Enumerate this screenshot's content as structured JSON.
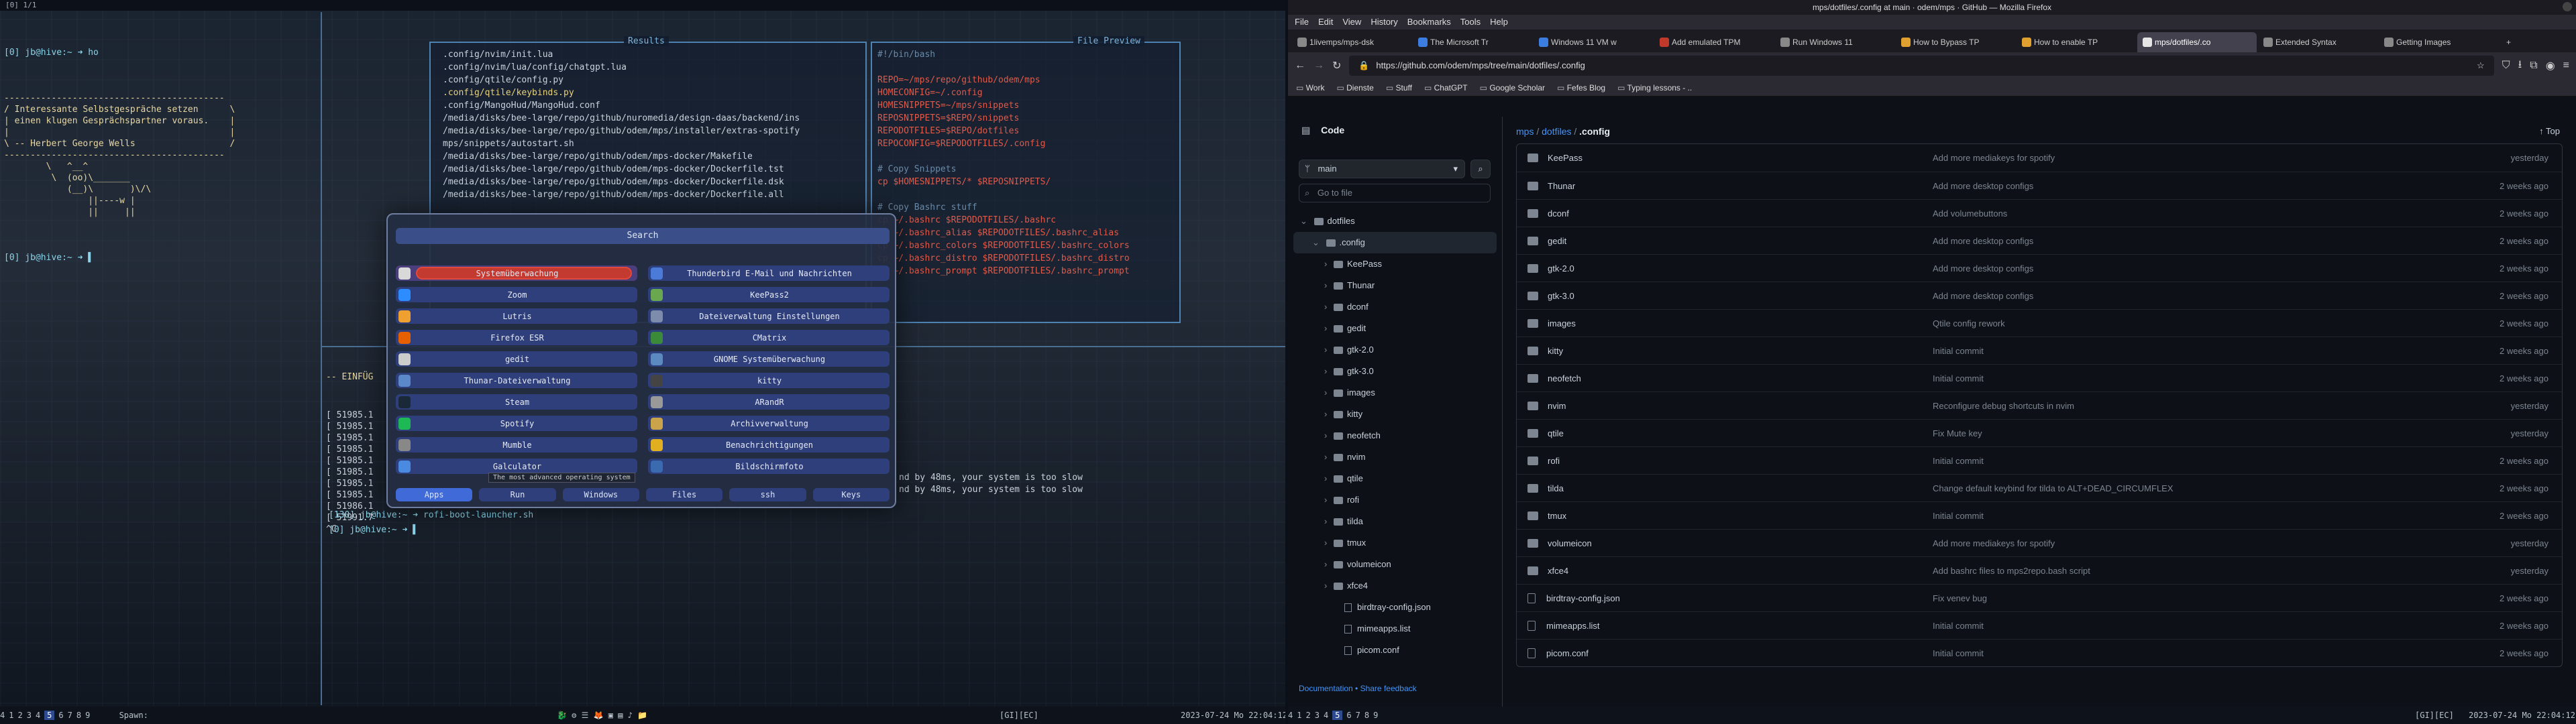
{
  "left": {
    "topbar": "[0] 1/1",
    "term1": {
      "prompt1": "[0] jb@hive:~ ➜ ho",
      "fortune": [
        "------------------------------------------",
        "/ Interessante Selbstgespräche setzen      \\",
        "| einen klugen Gesprächspartner voraus.    |",
        "|                                          |",
        "\\ -- Herbert George Wells                  /",
        "------------------------------------------",
        "        \\   ^__^",
        "         \\  (oo)\\_______",
        "            (__)\\       )\\/\\",
        "                ||----w |",
        "                ||     ||"
      ],
      "prompt2": "[0] jb@hive:~ ➜ ▌"
    },
    "results": {
      "title": "Results",
      "lines": [
        ".config/nvim/init.lua",
        ".config/nvim/lua/config/chatgpt.lua",
        ".config/qtile/config.py",
        ".config/qtile/keybinds.py",
        ".config/MangoHud/MangoHud.conf",
        "/media/disks/bee-large/repo/github/nuromedia/design-daas/backend/ins",
        "/media/disks/bee-large/repo/github/odem/mps/installer/extras-spotify",
        "mps/snippets/autostart.sh",
        "/media/disks/bee-large/repo/github/odem/mps-docker/Makefile",
        "/media/disks/bee-large/repo/github/odem/mps-docker/Dockerfile.tst",
        "/media/disks/bee-large/repo/github/odem/mps-docker/Dockerfile.dsk",
        "/media/disks/bee-large/repo/github/odem/mps-docker/Dockerfile.all"
      ]
    },
    "preview": {
      "title": "File Preview",
      "lines": [
        "#!/bin/bash",
        "",
        "REPO=~/mps/repo/github/odem/mps",
        "HOMECONFIG=~/.config",
        "HOMESNIPPETS=~/mps/snippets",
        "REPOSNIPPETS=$REPO/snippets",
        "REPODOTFILES=$REPO/dotfiles",
        "REPOCONFIG=$REPODOTFILES/.config",
        "",
        "# Copy Snippets",
        "cp $HOMESNIPPETS/* $REPOSNIPPETS/",
        "",
        "# Copy Bashrc stuff",
        "cp ~/.bashrc $REPODOTFILES/.bashrc",
        "cp ~/.bashrc_alias $REPODOTFILES/.bashrc_alias",
        "cp ~/.bashrc_colors $REPODOTFILES/.bashrc_colors",
        "cp ~/.bashrc_distro $REPODOTFILES/.bashrc_distro",
        "cp ~/.bashrc_prompt $REPODOTFILES/.bashrc_prompt"
      ]
    },
    "term2": {
      "header": "-- EINFÜG",
      "lines": [
        "[ 51985.1",
        "[ 51985.1",
        "[ 51985.1",
        "[ 51985.1",
        "[ 51985.1",
        "[ 51985.1",
        "[ 51985.1",
        "[ 51985.1",
        "[ 51986.1",
        "[ 51991.7",
        "^C"
      ],
      "slow1": "nd by 48ms, your system is too slow",
      "slow2": "nd by 48ms, your system is too slow",
      "prompt3": "[130] jb@hive:~ ➜ rofi-boot-launcher.sh",
      "prompt4": "[0] jb@hive:~ ➜ ▌"
    },
    "rofi": {
      "search": "Search",
      "items": [
        {
          "label": "Systemüberwachung",
          "color": "#d9d9d9"
        },
        {
          "label": "Thunderbird E-Mail und Nachrichten",
          "color": "#4a7bd8"
        },
        {
          "label": "Zoom",
          "color": "#2d8cff"
        },
        {
          "label": "KeePass2",
          "color": "#6aa84f"
        },
        {
          "label": "Lutris",
          "color": "#f0a030"
        },
        {
          "label": "Dateiverwaltung Einstellungen",
          "color": "#7d8cab"
        },
        {
          "label": "Firefox ESR",
          "color": "#e66000"
        },
        {
          "label": "CMatrix",
          "color": "#3a8a3a"
        },
        {
          "label": "gedit",
          "color": "#cccccc"
        },
        {
          "label": "GNOME Systemüberwachung",
          "color": "#5a8ac0"
        },
        {
          "label": "Thunar-Dateiverwaltung",
          "color": "#5b88c8"
        },
        {
          "label": "kitty",
          "color": "#444444"
        },
        {
          "label": "Steam",
          "color": "#1b2838"
        },
        {
          "label": "ARandR",
          "color": "#999999"
        },
        {
          "label": "Spotify",
          "color": "#1db954"
        },
        {
          "label": "Archivverwaltung",
          "color": "#c9a44a"
        },
        {
          "label": "Mumble",
          "color": "#888888"
        },
        {
          "label": "Benachrichtigungen",
          "color": "#e0b020"
        },
        {
          "label": "Galculator",
          "color": "#4a8ae0"
        },
        {
          "label": "Bildschirmfoto",
          "color": "#3a6ab0"
        }
      ],
      "tooltip": "The most advanced operating system",
      "tabs": [
        "Apps",
        "Run",
        "Windows",
        "Files",
        "ssh",
        "Keys"
      ]
    },
    "statusbar": {
      "workspaces": [
        "4",
        "1",
        "2",
        "3",
        "4",
        "5",
        "6",
        "7",
        "8",
        "9"
      ],
      "icons": "🐉 ⚙ ☰ 🦊 ▣ ▤ ♪ 📁",
      "layout": "[GI][EC]",
      "datetime": "2023-07-24 Mo 22:04:12",
      "spawn": "Spawn:"
    }
  },
  "right": {
    "window_title": "mps/dotfiles/.config at main · odem/mps · GitHub — Mozilla Firefox",
    "menu": [
      "File",
      "Edit",
      "View",
      "History",
      "Bookmarks",
      "Tools",
      "Help"
    ],
    "tabs": [
      "1livemps/mps-dsk",
      "The Microsoft Tr",
      "Windows 11 VM w",
      "Add emulated TPM",
      "Run Windows 11",
      "How to Bypass TP",
      "How to enable TP",
      "mps/dotfiles/.co",
      "Extended Syntax",
      "Getting Images"
    ],
    "url": "https://github.com/odem/mps/tree/main/dotfiles/.config",
    "bookmarks": [
      "Work",
      "Dienste",
      "Stuff",
      "ChatGPT",
      "Google Scholar",
      "Fefes Blog",
      "Typing lessons - .."
    ],
    "code_label": "Code",
    "branch": "main",
    "goto_placeholder": "Go to file",
    "breadcrumb": [
      "mps",
      "dotfiles",
      ".config"
    ],
    "top_label": "Top",
    "tree": [
      {
        "label": "dotfiles",
        "level": 0,
        "type": "dir"
      },
      {
        "label": ".config",
        "level": 1,
        "type": "dir",
        "sel": true
      },
      {
        "label": "KeePass",
        "level": 2,
        "type": "dir"
      },
      {
        "label": "Thunar",
        "level": 2,
        "type": "dir"
      },
      {
        "label": "dconf",
        "level": 2,
        "type": "dir"
      },
      {
        "label": "gedit",
        "level": 2,
        "type": "dir"
      },
      {
        "label": "gtk-2.0",
        "level": 2,
        "type": "dir"
      },
      {
        "label": "gtk-3.0",
        "level": 2,
        "type": "dir"
      },
      {
        "label": "images",
        "level": 2,
        "type": "dir"
      },
      {
        "label": "kitty",
        "level": 2,
        "type": "dir"
      },
      {
        "label": "neofetch",
        "level": 2,
        "type": "dir"
      },
      {
        "label": "nvim",
        "level": 2,
        "type": "dir"
      },
      {
        "label": "qtile",
        "level": 2,
        "type": "dir"
      },
      {
        "label": "rofi",
        "level": 2,
        "type": "dir"
      },
      {
        "label": "tilda",
        "level": 2,
        "type": "dir"
      },
      {
        "label": "tmux",
        "level": 2,
        "type": "dir"
      },
      {
        "label": "volumeicon",
        "level": 2,
        "type": "dir"
      },
      {
        "label": "xfce4",
        "level": 2,
        "type": "dir"
      },
      {
        "label": "birdtray-config.json",
        "level": 2,
        "type": "file"
      },
      {
        "label": "mimeapps.list",
        "level": 2,
        "type": "file"
      },
      {
        "label": "picom.conf",
        "level": 2,
        "type": "file"
      }
    ],
    "footer": "Documentation • Share feedback",
    "files": [
      {
        "name": "KeePass",
        "type": "dir",
        "commit": "Add more mediakeys for spotify",
        "date": "yesterday"
      },
      {
        "name": "Thunar",
        "type": "dir",
        "commit": "Add more desktop configs",
        "date": "2 weeks ago"
      },
      {
        "name": "dconf",
        "type": "dir",
        "commit": "Add volumebuttons",
        "date": "2 weeks ago"
      },
      {
        "name": "gedit",
        "type": "dir",
        "commit": "Add more desktop configs",
        "date": "2 weeks ago"
      },
      {
        "name": "gtk-2.0",
        "type": "dir",
        "commit": "Add more desktop configs",
        "date": "2 weeks ago"
      },
      {
        "name": "gtk-3.0",
        "type": "dir",
        "commit": "Add more desktop configs",
        "date": "2 weeks ago"
      },
      {
        "name": "images",
        "type": "dir",
        "commit": "Qtile config rework",
        "date": "2 weeks ago"
      },
      {
        "name": "kitty",
        "type": "dir",
        "commit": "Initial commit",
        "date": "2 weeks ago"
      },
      {
        "name": "neofetch",
        "type": "dir",
        "commit": "Initial commit",
        "date": "2 weeks ago"
      },
      {
        "name": "nvim",
        "type": "dir",
        "commit": "Reconfigure debug shortcuts in nvim",
        "date": "yesterday"
      },
      {
        "name": "qtile",
        "type": "dir",
        "commit": "Fix Mute key",
        "date": "yesterday"
      },
      {
        "name": "rofi",
        "type": "dir",
        "commit": "Initial commit",
        "date": "2 weeks ago"
      },
      {
        "name": "tilda",
        "type": "dir",
        "commit": "Change default keybind for tilda to ALT+DEAD_CIRCUMFLEX",
        "date": "2 weeks ago"
      },
      {
        "name": "tmux",
        "type": "dir",
        "commit": "Initial commit",
        "date": "2 weeks ago"
      },
      {
        "name": "volumeicon",
        "type": "dir",
        "commit": "Add more mediakeys for spotify",
        "date": "yesterday"
      },
      {
        "name": "xfce4",
        "type": "dir",
        "commit": "Add bashrc files to mps2repo.bash script",
        "date": "yesterday"
      },
      {
        "name": "birdtray-config.json",
        "type": "file",
        "commit": "Fix venev bug",
        "date": "2 weeks ago"
      },
      {
        "name": "mimeapps.list",
        "type": "file",
        "commit": "Initial commit",
        "date": "2 weeks ago"
      },
      {
        "name": "picom.conf",
        "type": "file",
        "commit": "Initial commit",
        "date": "2 weeks ago"
      }
    ],
    "statusbar": {
      "workspaces": [
        "4",
        "1",
        "2",
        "3",
        "4",
        "5",
        "6",
        "7",
        "8",
        "9"
      ],
      "layout": "[GI][EC]",
      "datetime": "2023-07-24 Mo 22:04:12"
    }
  }
}
